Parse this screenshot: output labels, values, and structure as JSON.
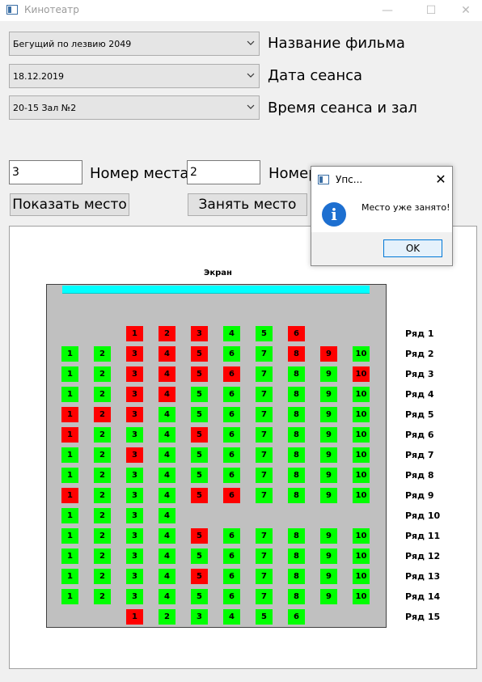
{
  "window": {
    "title": "Кинотеатр",
    "min_glyph": "—",
    "max_glyph": "☐",
    "close_glyph": "✕"
  },
  "form": {
    "film_select": {
      "value": "Бегущий по лезвию 2049",
      "label": "Название фильма"
    },
    "date_select": {
      "value": "18.12.2019",
      "label": "Дата сеанса"
    },
    "time_select": {
      "value": "20-15 Зал №2",
      "label": "Время сеанса и зал"
    },
    "seat_input": {
      "value": "3",
      "label": "Номер места"
    },
    "row_input": {
      "value": "2",
      "label": "Номер ряда"
    },
    "show_button": "Показать место",
    "take_button": "Занять место"
  },
  "hall": {
    "screen_label": "Экран",
    "colors": {
      "free": "#00ff00",
      "taken": "#ff0000",
      "screen": "#00ffff",
      "hall_bg": "#c0c0c0"
    },
    "rows": [
      {
        "label": "Ряд 1",
        "seats": [
          [
            3,
            "taken"
          ],
          [
            4,
            "taken"
          ],
          [
            5,
            "taken"
          ],
          [
            6,
            "free"
          ],
          [
            7,
            "free"
          ],
          [
            8,
            "taken"
          ]
        ],
        "numbers": [
          1,
          2,
          3,
          4,
          5,
          6
        ]
      },
      {
        "label": "Ряд 2",
        "seats": [
          [
            1,
            "free"
          ],
          [
            2,
            "free"
          ],
          [
            3,
            "taken"
          ],
          [
            4,
            "taken"
          ],
          [
            5,
            "taken"
          ],
          [
            6,
            "free"
          ],
          [
            7,
            "free"
          ],
          [
            8,
            "taken"
          ],
          [
            9,
            "taken"
          ],
          [
            10,
            "free"
          ]
        ]
      },
      {
        "label": "Ряд 3",
        "seats": [
          [
            1,
            "free"
          ],
          [
            2,
            "free"
          ],
          [
            3,
            "taken"
          ],
          [
            4,
            "taken"
          ],
          [
            5,
            "taken"
          ],
          [
            6,
            "taken"
          ],
          [
            7,
            "free"
          ],
          [
            8,
            "free"
          ],
          [
            9,
            "free"
          ],
          [
            10,
            "taken"
          ]
        ]
      },
      {
        "label": "Ряд 4",
        "seats": [
          [
            1,
            "free"
          ],
          [
            2,
            "free"
          ],
          [
            3,
            "taken"
          ],
          [
            4,
            "taken"
          ],
          [
            5,
            "free"
          ],
          [
            6,
            "free"
          ],
          [
            7,
            "free"
          ],
          [
            8,
            "free"
          ],
          [
            9,
            "free"
          ],
          [
            10,
            "free"
          ]
        ]
      },
      {
        "label": "Ряд 5",
        "seats": [
          [
            1,
            "taken"
          ],
          [
            2,
            "taken"
          ],
          [
            3,
            "taken"
          ],
          [
            4,
            "free"
          ],
          [
            5,
            "free"
          ],
          [
            6,
            "free"
          ],
          [
            7,
            "free"
          ],
          [
            8,
            "free"
          ],
          [
            9,
            "free"
          ],
          [
            10,
            "free"
          ]
        ]
      },
      {
        "label": "Ряд 6",
        "seats": [
          [
            1,
            "taken"
          ],
          [
            2,
            "free"
          ],
          [
            3,
            "free"
          ],
          [
            4,
            "free"
          ],
          [
            5,
            "taken"
          ],
          [
            6,
            "free"
          ],
          [
            7,
            "free"
          ],
          [
            8,
            "free"
          ],
          [
            9,
            "free"
          ],
          [
            10,
            "free"
          ]
        ]
      },
      {
        "label": "Ряд 7",
        "seats": [
          [
            1,
            "free"
          ],
          [
            2,
            "free"
          ],
          [
            3,
            "taken"
          ],
          [
            4,
            "free"
          ],
          [
            5,
            "free"
          ],
          [
            6,
            "free"
          ],
          [
            7,
            "free"
          ],
          [
            8,
            "free"
          ],
          [
            9,
            "free"
          ],
          [
            10,
            "free"
          ]
        ]
      },
      {
        "label": "Ряд 8",
        "seats": [
          [
            1,
            "free"
          ],
          [
            2,
            "free"
          ],
          [
            3,
            "free"
          ],
          [
            4,
            "free"
          ],
          [
            5,
            "free"
          ],
          [
            6,
            "free"
          ],
          [
            7,
            "free"
          ],
          [
            8,
            "free"
          ],
          [
            9,
            "free"
          ],
          [
            10,
            "free"
          ]
        ]
      },
      {
        "label": "Ряд 9",
        "seats": [
          [
            1,
            "taken"
          ],
          [
            2,
            "free"
          ],
          [
            3,
            "free"
          ],
          [
            4,
            "free"
          ],
          [
            5,
            "taken"
          ],
          [
            6,
            "taken"
          ],
          [
            7,
            "free"
          ],
          [
            8,
            "free"
          ],
          [
            9,
            "free"
          ],
          [
            10,
            "free"
          ]
        ]
      },
      {
        "label": "Ряд 10",
        "seats": [
          [
            1,
            "free"
          ],
          [
            2,
            "free"
          ],
          [
            3,
            "free"
          ],
          [
            4,
            "free"
          ]
        ]
      },
      {
        "label": "Ряд 11",
        "seats": [
          [
            1,
            "free"
          ],
          [
            2,
            "free"
          ],
          [
            3,
            "free"
          ],
          [
            4,
            "free"
          ],
          [
            5,
            "taken"
          ],
          [
            6,
            "free"
          ],
          [
            7,
            "free"
          ],
          [
            8,
            "free"
          ],
          [
            9,
            "free"
          ],
          [
            10,
            "free"
          ]
        ]
      },
      {
        "label": "Ряд 12",
        "seats": [
          [
            1,
            "free"
          ],
          [
            2,
            "free"
          ],
          [
            3,
            "free"
          ],
          [
            4,
            "free"
          ],
          [
            5,
            "free"
          ],
          [
            6,
            "free"
          ],
          [
            7,
            "free"
          ],
          [
            8,
            "free"
          ],
          [
            9,
            "free"
          ],
          [
            10,
            "free"
          ]
        ]
      },
      {
        "label": "Ряд 13",
        "seats": [
          [
            1,
            "free"
          ],
          [
            2,
            "free"
          ],
          [
            3,
            "free"
          ],
          [
            4,
            "free"
          ],
          [
            5,
            "taken"
          ],
          [
            6,
            "free"
          ],
          [
            7,
            "free"
          ],
          [
            8,
            "free"
          ],
          [
            9,
            "free"
          ],
          [
            10,
            "free"
          ]
        ]
      },
      {
        "label": "Ряд 14",
        "seats": [
          [
            1,
            "free"
          ],
          [
            2,
            "free"
          ],
          [
            3,
            "free"
          ],
          [
            4,
            "free"
          ],
          [
            5,
            "free"
          ],
          [
            6,
            "free"
          ],
          [
            7,
            "free"
          ],
          [
            8,
            "free"
          ],
          [
            9,
            "free"
          ],
          [
            10,
            "free"
          ]
        ]
      },
      {
        "label": "Ряд 15",
        "seats": [
          [
            3,
            "taken"
          ],
          [
            4,
            "free"
          ],
          [
            5,
            "free"
          ],
          [
            6,
            "free"
          ],
          [
            7,
            "free"
          ],
          [
            8,
            "free"
          ]
        ],
        "numbers": [
          1,
          2,
          3,
          4,
          5,
          6
        ]
      }
    ]
  },
  "dialog": {
    "title": "Упс...",
    "message": "Место уже занято!",
    "ok_button": "OK",
    "close_glyph": "✕",
    "info_glyph": "i"
  }
}
